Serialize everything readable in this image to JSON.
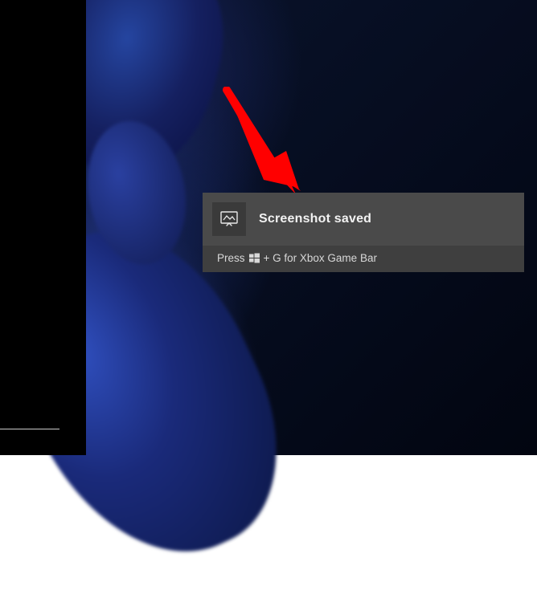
{
  "notification": {
    "title": "Screenshot saved",
    "hint_prefix": "Press",
    "hint_suffix": "+ G for Xbox Game Bar",
    "icon_name": "screenshot-icon",
    "key_glyph_name": "windows-key-icon"
  },
  "colors": {
    "toast_bg": "#3f3f3f",
    "toast_top_bg": "#4a4a4a",
    "arrow": "#ff0000"
  }
}
